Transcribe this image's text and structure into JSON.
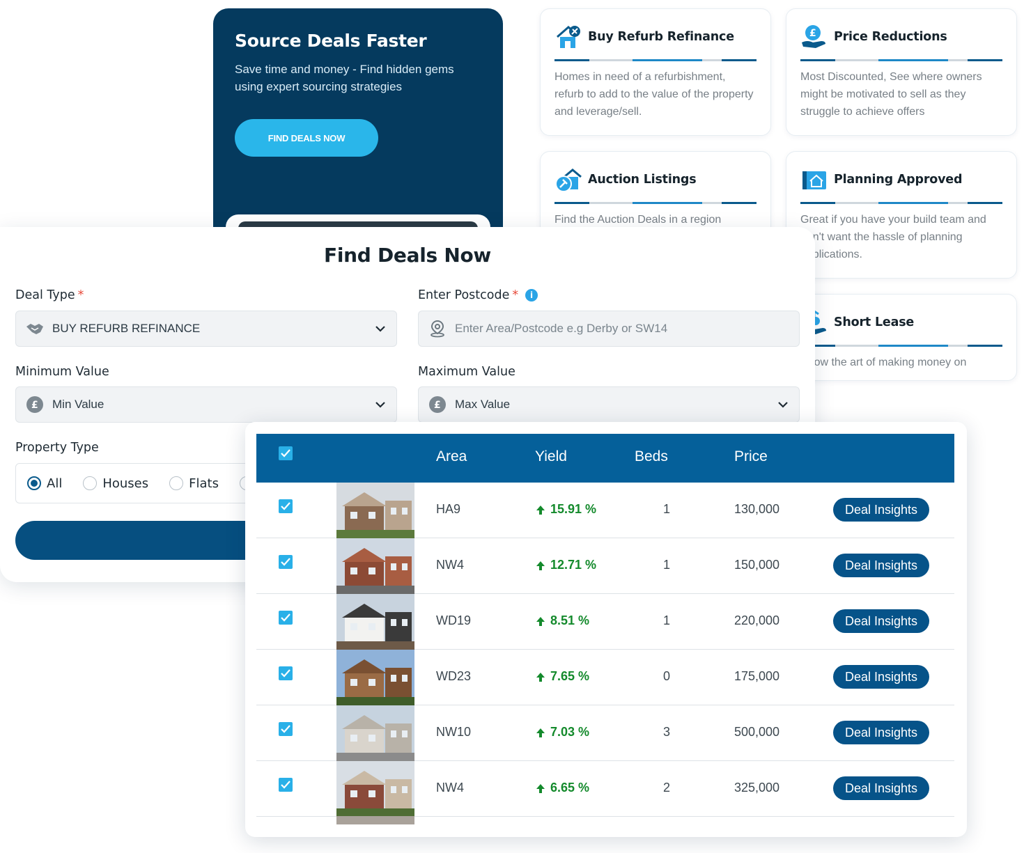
{
  "promo": {
    "title": "Source Deals Faster",
    "subtitle": "Save time and money - Find hidden gems using expert sourcing strategies",
    "button_label": "FIND DEALS NOW"
  },
  "feature_cards": [
    {
      "title": "Buy Refurb Refinance",
      "description": "Homes in need of a refurbishment, refurb to add to the value of the property and leverage/sell.",
      "icon": "house-tools-icon"
    },
    {
      "title": "Price Reductions",
      "description": "Most Discounted, See where owners might be motivated to sell as they struggle to achieve offers",
      "icon": "pound-hand-icon"
    },
    {
      "title": "Auction Listings",
      "description": "Find the Auction Deals in a region",
      "icon": "auction-house-icon"
    },
    {
      "title": "Planning Approved",
      "description": "Great if you have your build team and don't want the hassle of planning applications.",
      "icon": "blueprint-house-icon"
    },
    {
      "title": "Short Lease",
      "description": "Know the art of making money on",
      "icon": "lease-hand-icon"
    }
  ],
  "form": {
    "title": "Find Deals Now",
    "deal_type_label": "Deal Type",
    "deal_type_value": "BUY REFURB REFINANCE",
    "postcode_label": "Enter Postcode",
    "postcode_placeholder": "Enter Area/Postcode e.g Derby or SW14",
    "min_label": "Minimum Value",
    "min_value": "Min Value",
    "max_label": "Maximum Value",
    "max_value": "Max Value",
    "property_type_label": "Property Type",
    "property_types": [
      "All",
      "Houses",
      "Flats"
    ],
    "selected_property_type": "All",
    "required_mark": "*",
    "info_mark": "i"
  },
  "table": {
    "headers": {
      "area": "Area",
      "yield": "Yield",
      "beds": "Beds",
      "price": "Price"
    },
    "rows": [
      {
        "area": "HA9",
        "yield": "15.91 %",
        "beds": "1",
        "price": "130,000",
        "action": "Deal Insights"
      },
      {
        "area": "NW4",
        "yield": "12.71 %",
        "beds": "1",
        "price": "150,000",
        "action": "Deal Insights"
      },
      {
        "area": "WD19",
        "yield": "8.51 %",
        "beds": "1",
        "price": "220,000",
        "action": "Deal Insights"
      },
      {
        "area": "WD23",
        "yield": "7.65 %",
        "beds": "0",
        "price": "175,000",
        "action": "Deal Insights"
      },
      {
        "area": "NW10",
        "yield": "7.03 %",
        "beds": "3",
        "price": "500,000",
        "action": "Deal Insights"
      },
      {
        "area": "NW4",
        "yield": "6.65 %",
        "beds": "2",
        "price": "325,000",
        "action": "Deal Insights"
      }
    ]
  },
  "colors": {
    "navy": "#053a5e",
    "accent_cyan": "#2ab6ea",
    "table_header": "#05609a",
    "yield_green": "#148a2c",
    "button_blue": "#065389"
  }
}
